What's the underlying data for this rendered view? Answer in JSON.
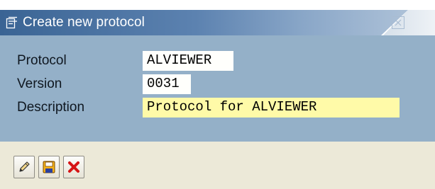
{
  "window": {
    "title": "Create new protocol",
    "title_icon": "document-create-icon",
    "close_icon": "close-icon"
  },
  "form": {
    "protocol": {
      "label": "Protocol",
      "value": "ALVIEWER"
    },
    "version": {
      "label": "Version",
      "value": "0031"
    },
    "description": {
      "label": "Description",
      "value": "Protocol for ALVIEWER"
    }
  },
  "toolbar": {
    "buttons": [
      {
        "icon": "pencil-edit-icon"
      },
      {
        "icon": "save-floppy-icon"
      },
      {
        "icon": "cancel-x-icon"
      }
    ]
  },
  "colors": {
    "titlebar": "#3a6494",
    "form_background": "#94b0c8",
    "required_field": "#fffaa8",
    "toolbar_background": "#ece9d8"
  }
}
